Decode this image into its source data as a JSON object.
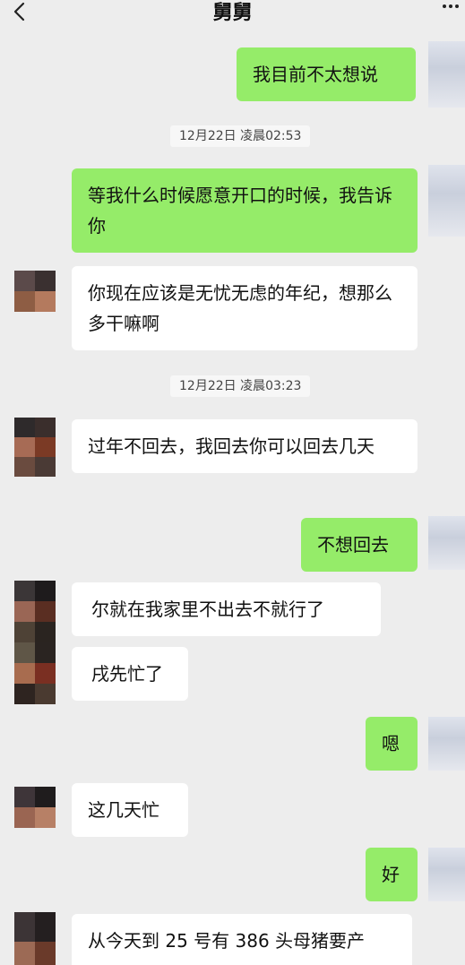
{
  "header": {
    "title": "舅舅"
  },
  "icons": {
    "back": "chevron-left-icon",
    "more": "more-dots-icon"
  },
  "colors": {
    "background": "#ededed",
    "my_bubble": "#95ec69",
    "their_bubble": "#ffffff"
  },
  "messages": [
    {
      "from": "me",
      "text": "我目前不太想说"
    },
    {
      "time": "12月22日 凌晨02:53"
    },
    {
      "from": "me",
      "text": "等我什么时候愿意开口的时候，我告诉你"
    },
    {
      "from": "them",
      "text": "你现在应该是无忧无虑的年纪，想那么多干嘛啊"
    },
    {
      "time": "12月22日 凌晨03:23"
    },
    {
      "from": "them",
      "text": "过年不回去，我回去你可以回去几天"
    },
    {
      "from": "me",
      "text": "不想回去"
    },
    {
      "from": "them",
      "text": "尔就在我家里不出去不就行了"
    },
    {
      "from": "them",
      "text": "戌先忙了"
    },
    {
      "from": "me",
      "text": "嗯"
    },
    {
      "from": "them",
      "text": "这几天忙"
    },
    {
      "from": "me",
      "text": "好"
    },
    {
      "from": "them",
      "text": "从今天到 25 号有 386 头母猪要产"
    }
  ]
}
